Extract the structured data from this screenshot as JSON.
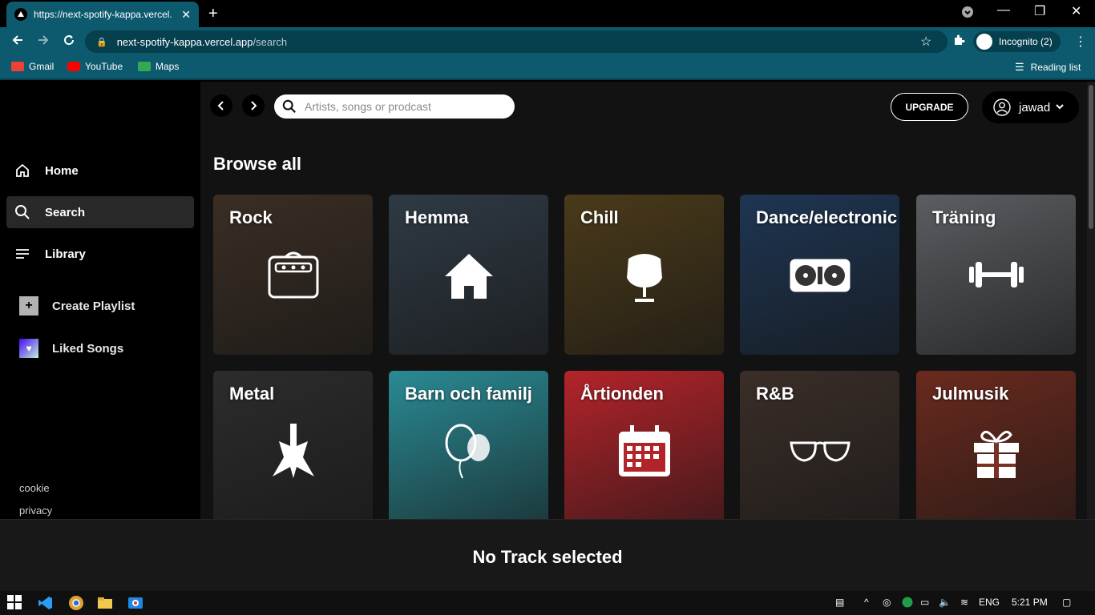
{
  "browser": {
    "tab_title": "https://next-spotify-kappa.vercel.",
    "url_host": "next-spotify-kappa.vercel.app",
    "url_path": "/search",
    "incognito_label": "Incognito (2)",
    "bookmarks": [
      {
        "label": "Gmail",
        "icon": "gmail-icon",
        "color": "#ea4335"
      },
      {
        "label": "YouTube",
        "icon": "youtube-icon",
        "color": "#ff0000"
      },
      {
        "label": "Maps",
        "icon": "maps-icon",
        "color": "#34a853"
      }
    ],
    "reading_list": "Reading list"
  },
  "sidebar": {
    "nav": [
      {
        "label": "Home",
        "icon": "home-icon"
      },
      {
        "label": "Search",
        "icon": "search-icon",
        "active": true
      },
      {
        "label": "Library",
        "icon": "library-icon"
      }
    ],
    "create_playlist": "Create Playlist",
    "liked_songs": "Liked Songs",
    "footer": [
      "cookie",
      "privacy"
    ]
  },
  "header": {
    "search_placeholder": "Artists, songs or prodcast",
    "upgrade": "UPGRADE",
    "username": "jawad"
  },
  "browse": {
    "title": "Browse all",
    "categories": [
      {
        "label": "Rock",
        "icon": "amplifier-icon",
        "color": "#3a2e24"
      },
      {
        "label": "Hemma",
        "icon": "house-icon",
        "color": "#2f3a44"
      },
      {
        "label": "Chill",
        "icon": "egg-chair-icon",
        "color": "#4a3a1a"
      },
      {
        "label": "Dance/electronic",
        "icon": "turntable-icon",
        "color": "#1e3552"
      },
      {
        "label": "Träning",
        "icon": "dumbbell-icon",
        "color": "#5a5e62"
      },
      {
        "label": "Metal",
        "icon": "guitar-icon",
        "color": "#2c2c2c"
      },
      {
        "label": "Barn och familj",
        "icon": "balloon-icon",
        "color": "#2a8a94"
      },
      {
        "label": "Årtionden",
        "icon": "calendar-icon",
        "color": "#b3242a"
      },
      {
        "label": "R&B",
        "icon": "sunglasses-icon",
        "color": "#3a2e28"
      },
      {
        "label": "Julmusik",
        "icon": "gift-icon",
        "color": "#6a2a1e"
      }
    ]
  },
  "player": {
    "message": "No Track selected"
  },
  "taskbar": {
    "lang": "ENG",
    "time": "5:21 PM"
  }
}
